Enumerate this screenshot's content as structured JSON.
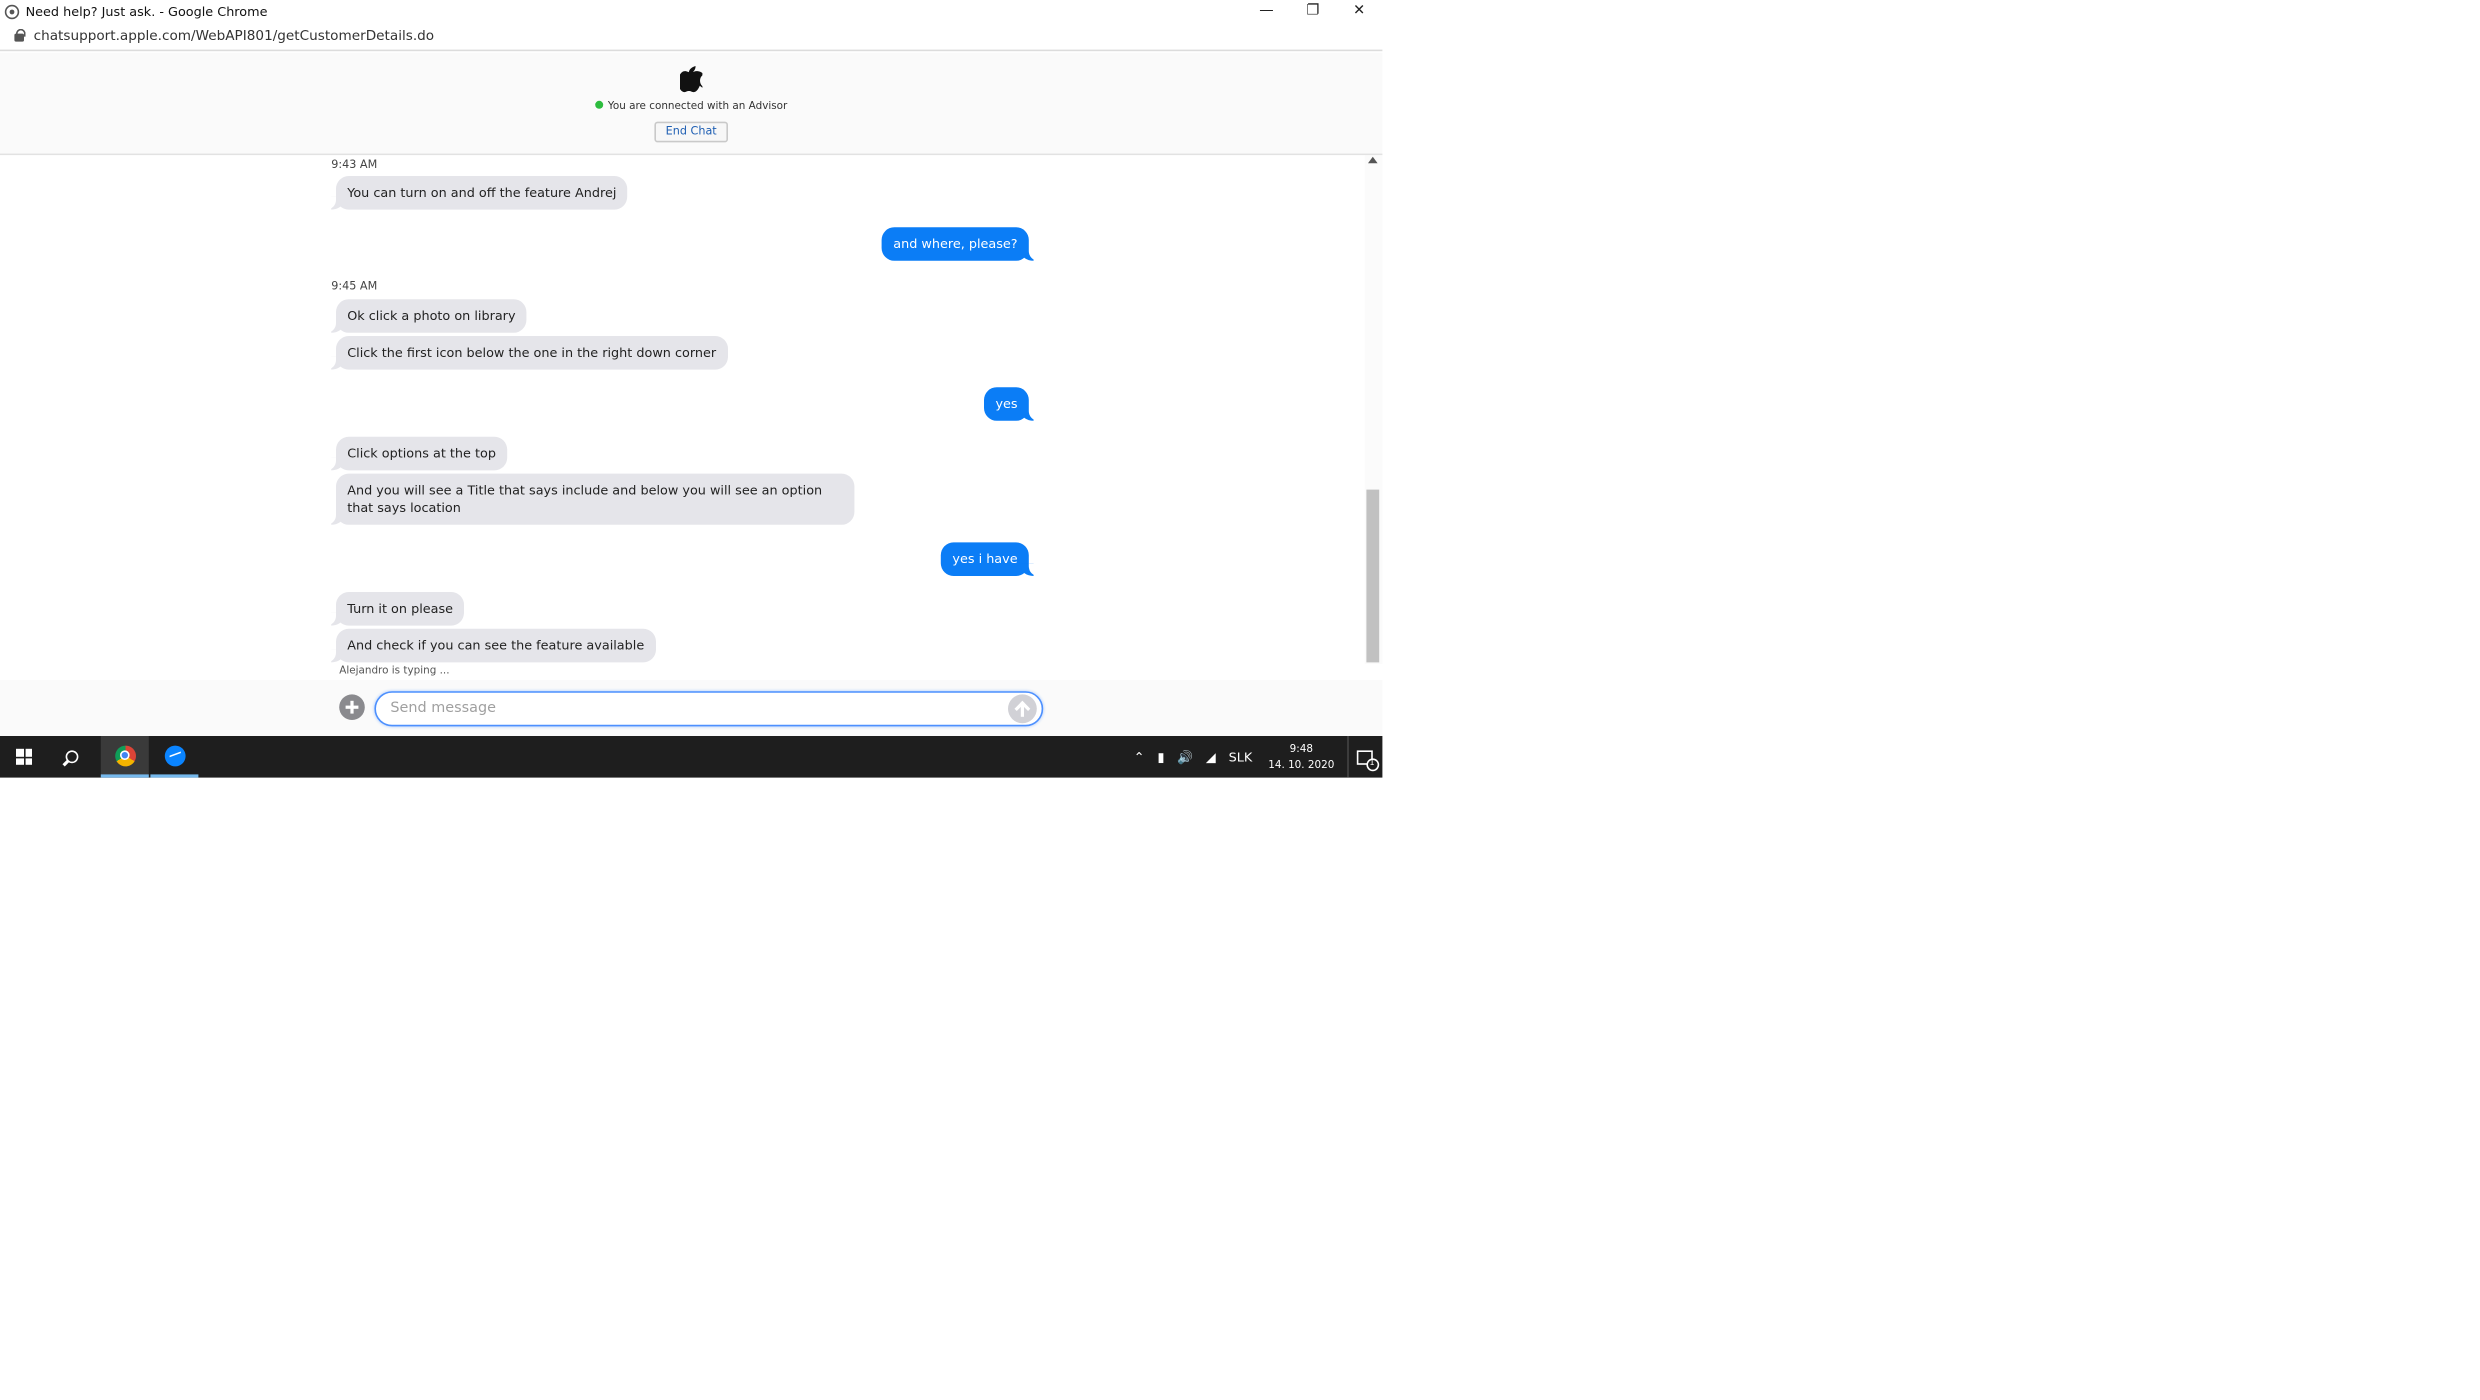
{
  "window": {
    "title": "Need help? Just ask. - Google Chrome"
  },
  "address_bar": {
    "url": "chatsupport.apple.com/WebAPI801/getCustomerDetails.do"
  },
  "header": {
    "status_text": "You are connected with an Advisor",
    "end_chat_label": "End Chat"
  },
  "messages": [
    {
      "type": "timestamp",
      "text": "9:43 AM"
    },
    {
      "type": "in",
      "text": "You can turn on and off the feature Andrej"
    },
    {
      "type": "out",
      "text": "and where, please?"
    },
    {
      "type": "timestamp",
      "text": "9:45 AM"
    },
    {
      "type": "in",
      "text": "Ok click a photo on library"
    },
    {
      "type": "in",
      "text": "Click the first icon below the one in the right down corner"
    },
    {
      "type": "out",
      "text": "yes"
    },
    {
      "type": "in",
      "text": "Click options at the top"
    },
    {
      "type": "in",
      "text": "And you will see a Title that says include and below you will see an option that says location"
    },
    {
      "type": "out",
      "text": "yes i have"
    },
    {
      "type": "in",
      "text": "Turn it on please"
    },
    {
      "type": "in",
      "text": "And check if you can see the feature available"
    }
  ],
  "typing_indicator": "Alejandro is typing ...",
  "composer": {
    "placeholder": "Send message",
    "value": ""
  },
  "taskbar": {
    "language": "SLK",
    "time": "9:48",
    "date": "14. 10. 2020"
  },
  "colors": {
    "outgoing_bubble": "#0b7df6",
    "incoming_bubble": "#e5e5ea",
    "status_dot": "#2dbc3e",
    "taskbar": "#1e1e1e"
  }
}
